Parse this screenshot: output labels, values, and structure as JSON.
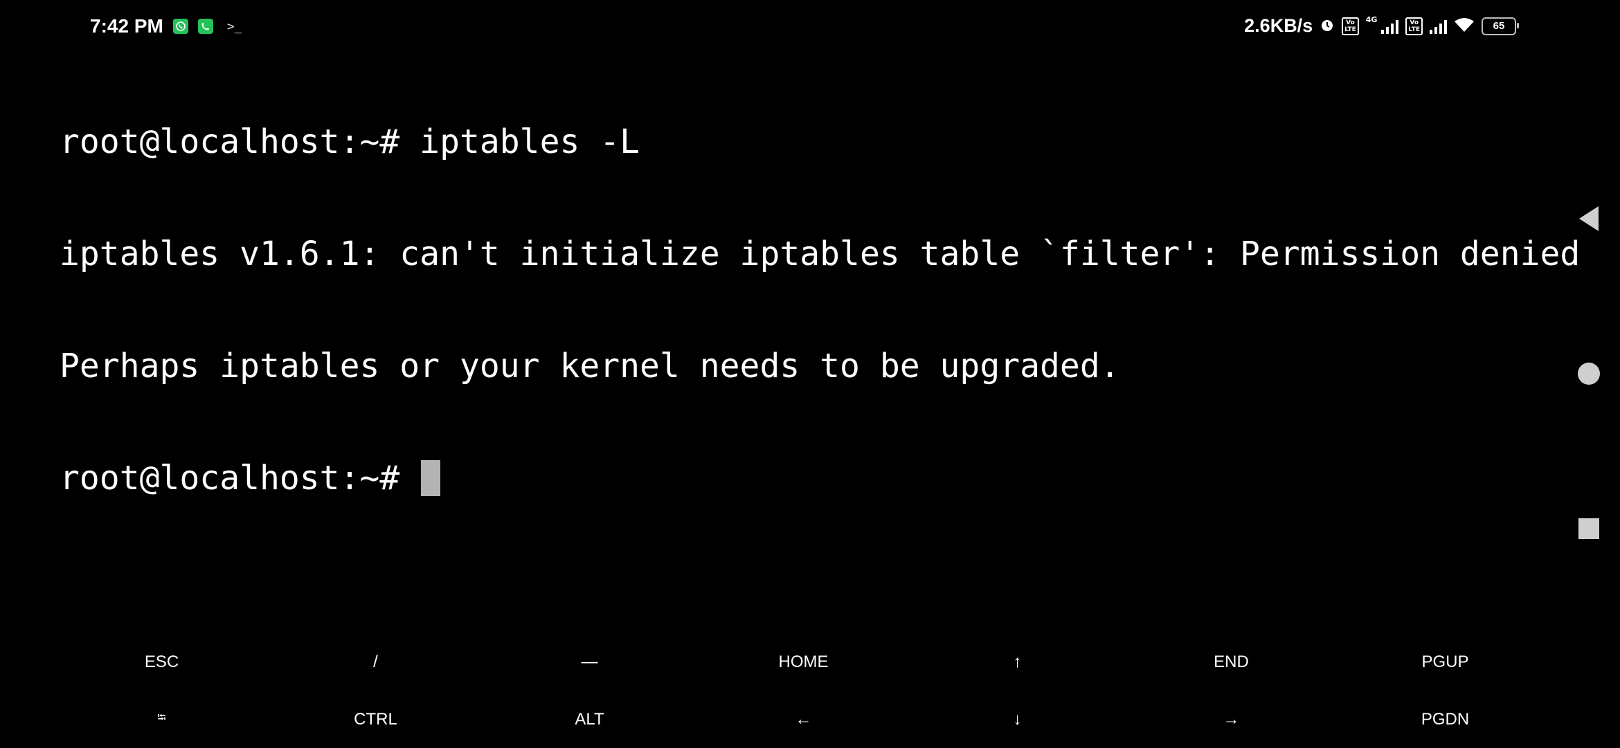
{
  "status_bar": {
    "time": "7:42 PM",
    "speed": "2.6KB/s",
    "network_label": "4G",
    "volte_label": "Vo LTE",
    "battery": "65"
  },
  "terminal": {
    "lines": [
      "root@localhost:~# iptables -L",
      "iptables v1.6.1: can't initialize iptables table `filter': Permission denied",
      "Perhaps iptables or your kernel needs to be upgraded.",
      "root@localhost:~# "
    ]
  },
  "extra_keys": {
    "row1": [
      "ESC",
      "/",
      "—",
      "HOME",
      "↑",
      "END",
      "PGUP"
    ],
    "row2": [
      "⭾",
      "CTRL",
      "ALT",
      "←",
      "↓",
      "→",
      "PGDN"
    ]
  },
  "icons": {
    "whatsapp": "whatsapp-icon",
    "phone": "phone-icon",
    "terminal": "terminal-icon",
    "alarm": "alarm-icon",
    "signal": "signal-icon",
    "wifi": "wifi-icon",
    "battery": "battery-icon",
    "back": "back-icon",
    "home": "home-icon",
    "recents": "recents-icon"
  },
  "colors": {
    "background": "#000000",
    "text": "#ffffff",
    "cursor": "#b3b3b3",
    "app_icon_green": "#25c15a"
  }
}
